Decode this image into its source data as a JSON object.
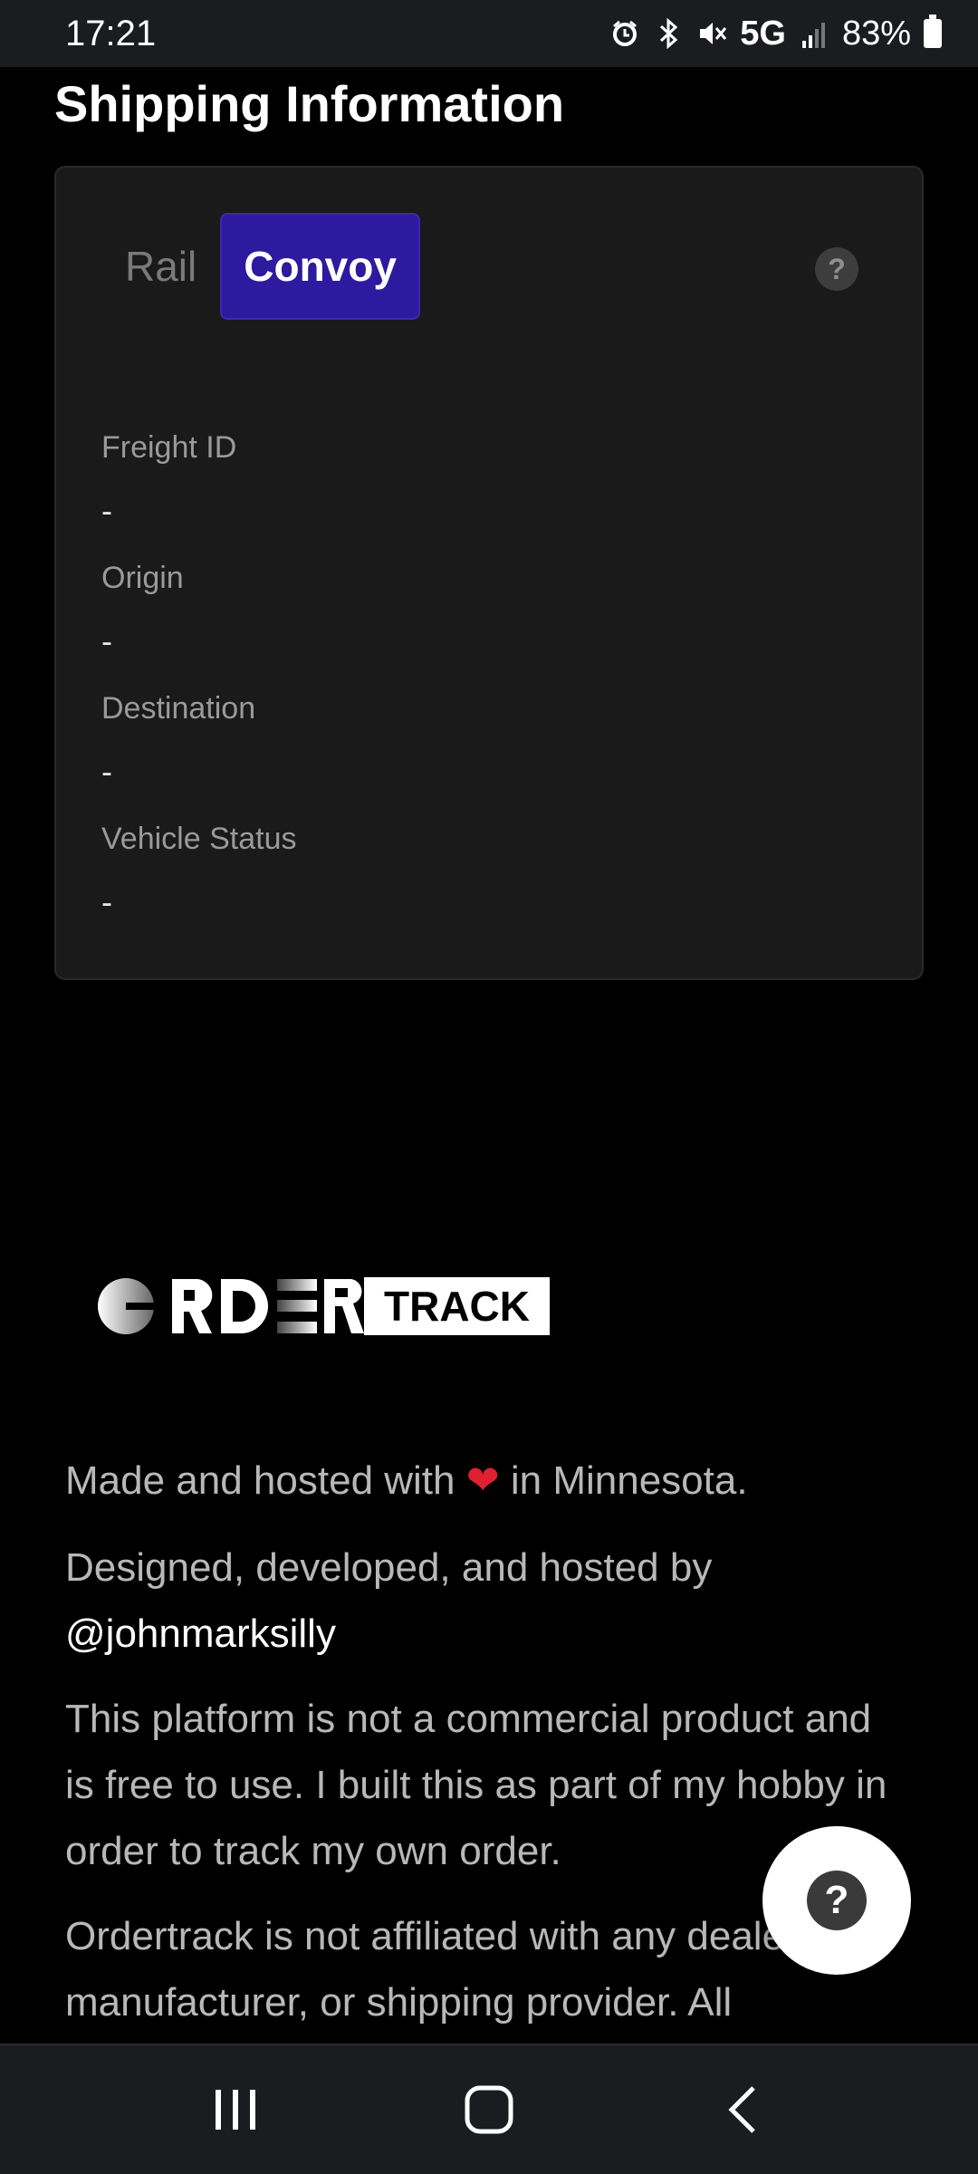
{
  "status_bar": {
    "time": "17:21",
    "network": "5G",
    "battery": "83%",
    "icons": [
      "alarm-icon",
      "bluetooth-icon",
      "mute-icon",
      "signal-icon",
      "battery-icon"
    ]
  },
  "section": {
    "title": "Shipping Information"
  },
  "tabs": {
    "rail": "Rail",
    "convoy": "Convoy",
    "active": "Convoy"
  },
  "fields": [
    {
      "label": "Freight ID",
      "value": "-"
    },
    {
      "label": "Origin",
      "value": "-"
    },
    {
      "label": "Destination",
      "value": "-"
    },
    {
      "label": "Vehicle Status",
      "value": "-"
    }
  ],
  "logo": {
    "track_text": "TRACK"
  },
  "footer": {
    "made_prefix": "Made and hosted with",
    "heart": "❤",
    "made_suffix": "in Minnesota.",
    "designed": "Designed, developed, and hosted by",
    "handle": "@johnmarksilly",
    "disclaimer1": "This platform is not a commercial product and is free to use. I built this as part of my hobby in order to track my own order.",
    "disclaimer2": "Ordertrack is not affiliated with any dealer, manufacturer, or shipping provider. All"
  },
  "fab": {
    "icon": "?"
  },
  "help_icon": "?",
  "colors": {
    "accent": "#2d1a9e",
    "card_bg": "#1a1a1a",
    "bg": "#000000"
  }
}
